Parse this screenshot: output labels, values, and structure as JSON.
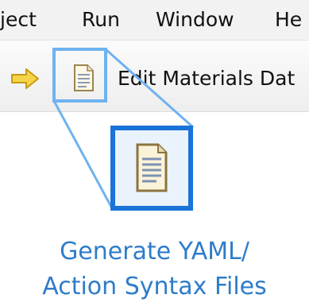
{
  "menubar": {
    "items": [
      "ject",
      "Run",
      "Window",
      "He"
    ]
  },
  "toolbar": {
    "edit_label": "Edit Materials Dat",
    "back_icon": "forward-arrow-icon",
    "doc_icon": "document-icon"
  },
  "callout": {
    "line1": "Generate YAML/",
    "line2": "Action Syntax Files"
  },
  "colors": {
    "accent": "#1a73d9",
    "caption": "#2e7cc9",
    "callout_line": "#6fb3f0",
    "arrow": "#f3c21a"
  }
}
